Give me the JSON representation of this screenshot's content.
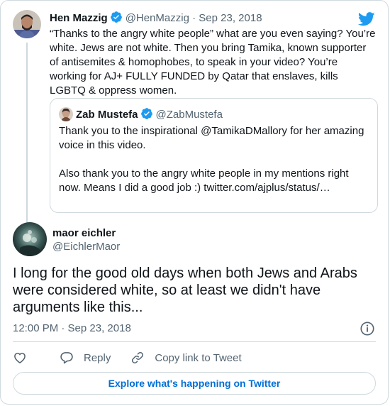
{
  "colors": {
    "accent": "#1d9bf0",
    "link": "#006fd6",
    "text": "#0f1419",
    "muted": "#536471",
    "border": "#cfd9de"
  },
  "icons": [
    "twitter-bird-icon",
    "verified-badge-icon",
    "info-icon",
    "heart-icon",
    "reply-icon",
    "link-icon"
  ],
  "parent_tweet": {
    "author_name": "Hen Mazzig",
    "handle": "@HenMazzig",
    "separator": " · ",
    "date": "Sep 23, 2018",
    "text": "“Thanks to the angry white people” what are you even saying? You’re white. Jews are not white. Then you bring Tamika, known supporter of antisemites & homophobes, to speak in your video? You’re working for AJ+ FULLY FUNDED by Qatar that enslaves, kills LGBTQ & oppress women."
  },
  "quoted_tweet": {
    "author_name": "Zab Mustefa",
    "handle": "@ZabMustefa",
    "text_1": "Thank you to the inspirational @TamikaDMallory for her amazing voice in this video.",
    "text_2": "Also thank you to the angry white people in my mentions right now. Means I did a good job :) twitter.com/ajplus/status/…"
  },
  "main_tweet": {
    "author_name": "maor eichler",
    "handle": "@EichlerMaor",
    "text": "I long for the good old days when both Jews and Arabs were considered white, so at least we didn't have arguments like this...",
    "timestamp": "12:00 PM · Sep 23, 2018"
  },
  "actions": {
    "reply_label": "Reply",
    "copy_link_label": "Copy link to Tweet"
  },
  "explore_label": "Explore what's happening on Twitter"
}
